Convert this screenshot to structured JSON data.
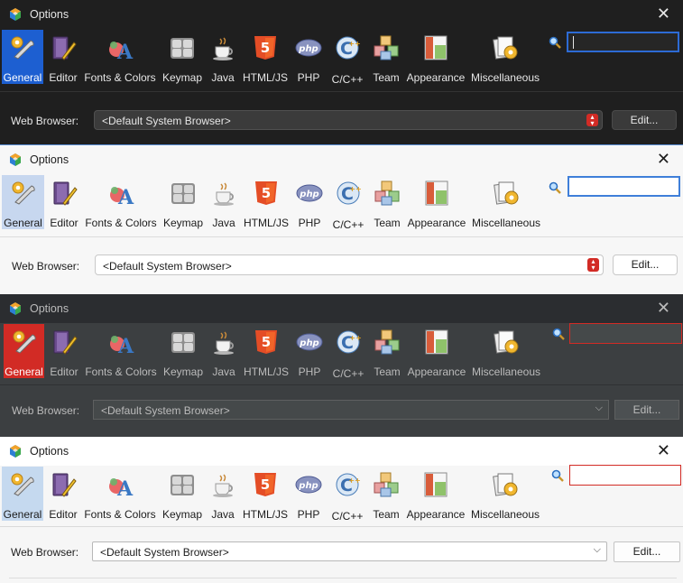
{
  "window": {
    "title": "Options"
  },
  "toolbar": {
    "items": [
      {
        "label": "General",
        "icon": "wrench-gear-icon"
      },
      {
        "label": "Editor",
        "icon": "book-pencil-icon"
      },
      {
        "label": "Fonts & Colors",
        "icon": "font-palette-icon"
      },
      {
        "label": "Keymap",
        "icon": "keyboard-icon"
      },
      {
        "label": "Java",
        "icon": "coffee-cup-icon"
      },
      {
        "label": "HTML/JS",
        "icon": "html5-shield-icon"
      },
      {
        "label": "PHP",
        "icon": "php-oval-icon"
      },
      {
        "label": "C/C++",
        "icon": "c-plus-plus-icon"
      },
      {
        "label": "Team",
        "icon": "cubes-icon"
      },
      {
        "label": "Appearance",
        "icon": "layout-window-icon"
      },
      {
        "label": "Miscellaneous",
        "icon": "papers-gear-icon"
      }
    ],
    "selected": "General"
  },
  "search": {
    "value": "",
    "icon": "magnifier-icon"
  },
  "web_browser": {
    "label": "Web Browser:",
    "value": "<Default System Browser>",
    "edit_label": "Edit..."
  },
  "themes": [
    {
      "name": "dark-flatlaf",
      "accent": "#1d5fd1"
    },
    {
      "name": "light-flatlaf",
      "accent": "#c7d7ef"
    },
    {
      "name": "dark-metal",
      "accent": "#d22b25"
    },
    {
      "name": "light-windows",
      "accent": "#c5d9ef"
    }
  ]
}
